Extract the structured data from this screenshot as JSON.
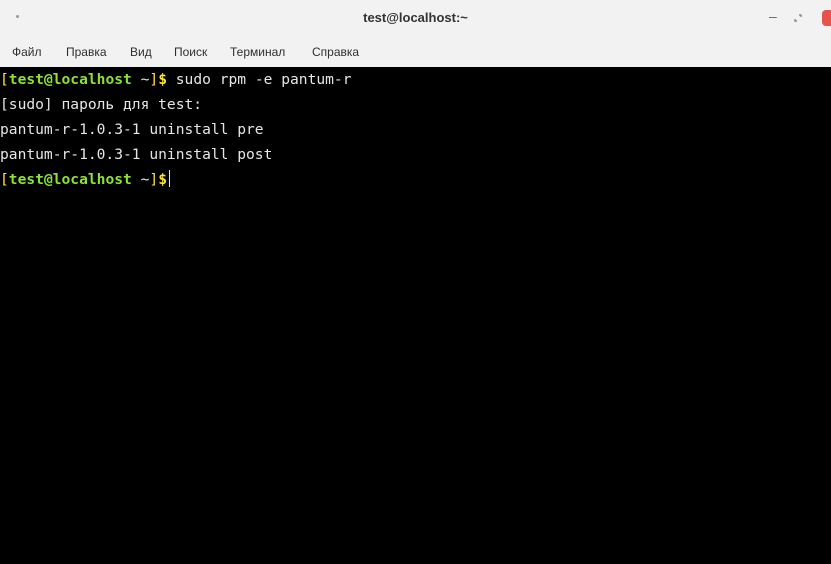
{
  "window": {
    "title": "test@localhost:~"
  },
  "menu": {
    "items": [
      "Файл",
      "Правка",
      "Вид",
      "Поиск",
      "Терминал",
      "Справка"
    ]
  },
  "terminal": {
    "prompt": {
      "open_bracket": "[",
      "user_host": "test@localhost",
      "path": " ~",
      "close_bracket": "]",
      "dollar": "$"
    },
    "command": " sudo rpm -e pantum-r",
    "output": [
      "[sudo] пароль для test:",
      "pantum-r-1.0.3-1 uninstall pre",
      "pantum-r-1.0.3-1 uninstall post"
    ]
  },
  "colors": {
    "prompt_user": "#8ae234",
    "prompt_bracket": "#ffe23a",
    "terminal_bg": "#000000",
    "terminal_fg": "#e6e6e6",
    "close_button": "#e8534b"
  },
  "icons": {
    "window_menu": "window-menu-dot-icon",
    "minimize": "minimize-icon",
    "maximize": "maximize-icon",
    "close": "close-icon"
  }
}
